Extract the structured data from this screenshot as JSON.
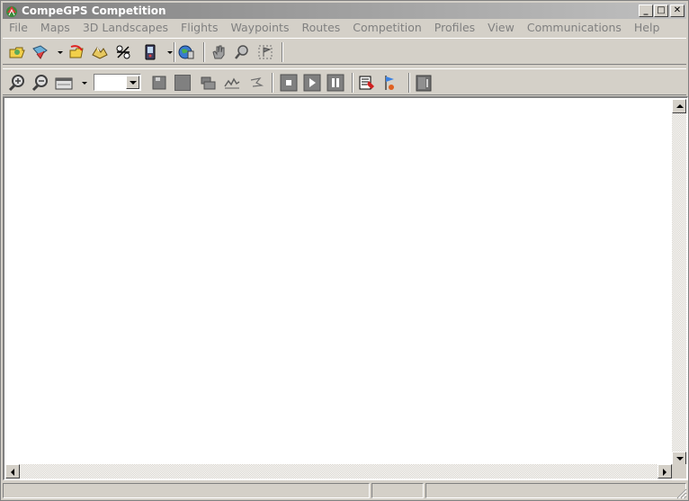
{
  "window": {
    "title": "CompeGPS Competition",
    "controls": {
      "minimize": "_",
      "maximize": "□",
      "close": "✕"
    }
  },
  "menubar": {
    "items": [
      "File",
      "Maps",
      "3D Landscapes",
      "Flights",
      "Waypoints",
      "Routes",
      "Competition",
      "Profiles",
      "View",
      "Communications",
      "Help"
    ]
  },
  "toolbar1": {
    "icons": [
      "open-folder-icon",
      "open-map-icon",
      "dropdown-arrow-icon",
      "open-track-icon",
      "3d-landscape-icon",
      "waypoints-icon",
      "gps-device-icon",
      "dropdown-arrow-icon",
      "route-globe-icon",
      "hand-pan-icon",
      "zoom-tool-icon",
      "flag-select-icon"
    ]
  },
  "toolbar2": {
    "icons": [
      "zoom-in-icon",
      "zoom-out-icon",
      "map-view-icon",
      "dropdown-arrow-icon",
      "scale-combo",
      "save-disk-icon",
      "grey-square-icon",
      "layers-icon",
      "profile-graph-icon",
      "wind-icon",
      "stop-icon",
      "play-icon",
      "pause-icon",
      "analysis-icon",
      "flag-marker-icon",
      "gps-connect-icon"
    ],
    "combo_value": ""
  },
  "colors": {
    "titlebar_start": "#808080",
    "titlebar_end": "#c0c0c0",
    "face": "#d4d0c8",
    "menu_text_disabled": "#808080"
  }
}
